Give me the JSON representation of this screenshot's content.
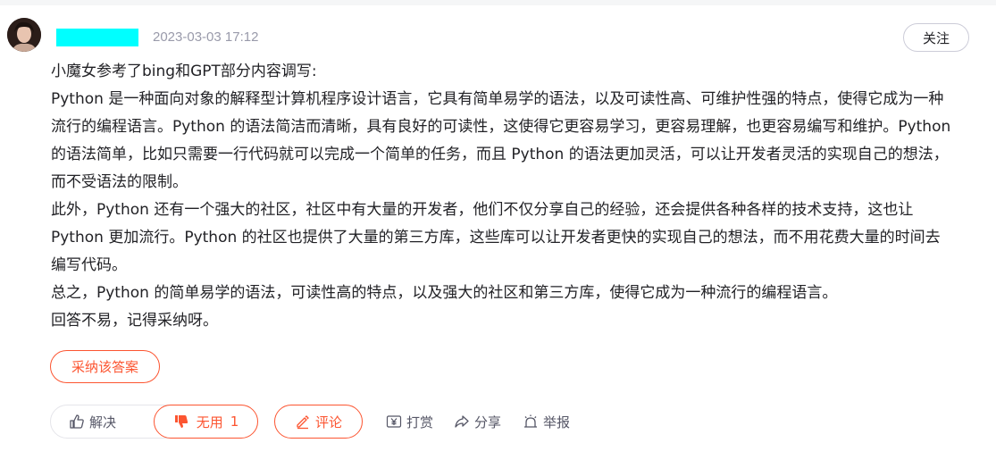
{
  "post": {
    "timestamp": "2023-03-03 17:12",
    "follow_label": "关注"
  },
  "content": {
    "paragraphs": [
      "小魔女参考了bing和GPT部分内容调写:",
      "Python 是一种面向对象的解释型计算机程序设计语言，它具有简单易学的语法，以及可读性高、可维护性强的特点，使得它成为一种流行的编程语言。Python 的语法简洁而清晰，具有良好的可读性，这使得它更容易学习，更容易理解，也更容易编写和维护。Python 的语法简单，比如只需要一行代码就可以完成一个简单的任务，而且 Python 的语法更加灵活，可以让开发者灵活的实现自己的想法，而不受语法的限制。",
      "此外，Python 还有一个强大的社区，社区中有大量的开发者，他们不仅分享自己的经验，还会提供各种各样的技术支持，这也让 Python 更加流行。Python 的社区也提供了大量的第三方库，这些库可以让开发者更快的实现自己的想法，而不用花费大量的时间去编写代码。",
      "总之，Python 的简单易学的语法，可读性高的特点，以及强大的社区和第三方库，使得它成为一种流行的编程语言。",
      "回答不易，记得采纳呀。"
    ]
  },
  "actions": {
    "accept_label": "采纳该答案",
    "solve_label": "解决",
    "useless_label": "无用",
    "useless_count": "1",
    "comment_label": "评论",
    "reward_label": "打赏",
    "share_label": "分享",
    "report_label": "举报"
  },
  "colors": {
    "accent": "#fc5531",
    "text": "#222226",
    "muted": "#999aaa",
    "redaction": "#00ffff"
  }
}
